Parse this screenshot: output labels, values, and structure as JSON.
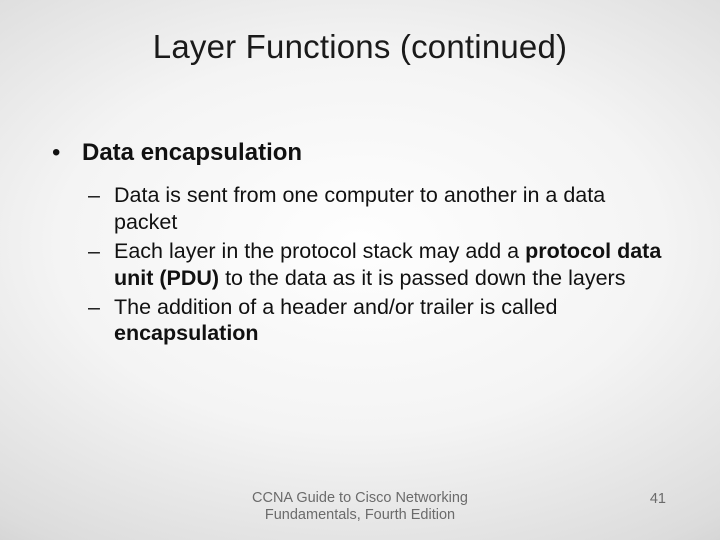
{
  "title": "Layer Functions (continued)",
  "body": {
    "heading": "Data encapsulation",
    "items": [
      {
        "pre": "Data is sent from one computer to another in a data packet",
        "bold": "",
        "post": ""
      },
      {
        "pre": "Each layer in the protocol stack may add a ",
        "bold": "protocol data unit (PDU)",
        "post": " to the data as it is passed down the layers"
      },
      {
        "pre": "The addition of a header and/or trailer is called ",
        "bold": "encapsulation",
        "post": ""
      }
    ]
  },
  "footer": {
    "source_line1": "CCNA Guide to Cisco Networking",
    "source_line2": "Fundamentals, Fourth Edition",
    "page": "41"
  }
}
